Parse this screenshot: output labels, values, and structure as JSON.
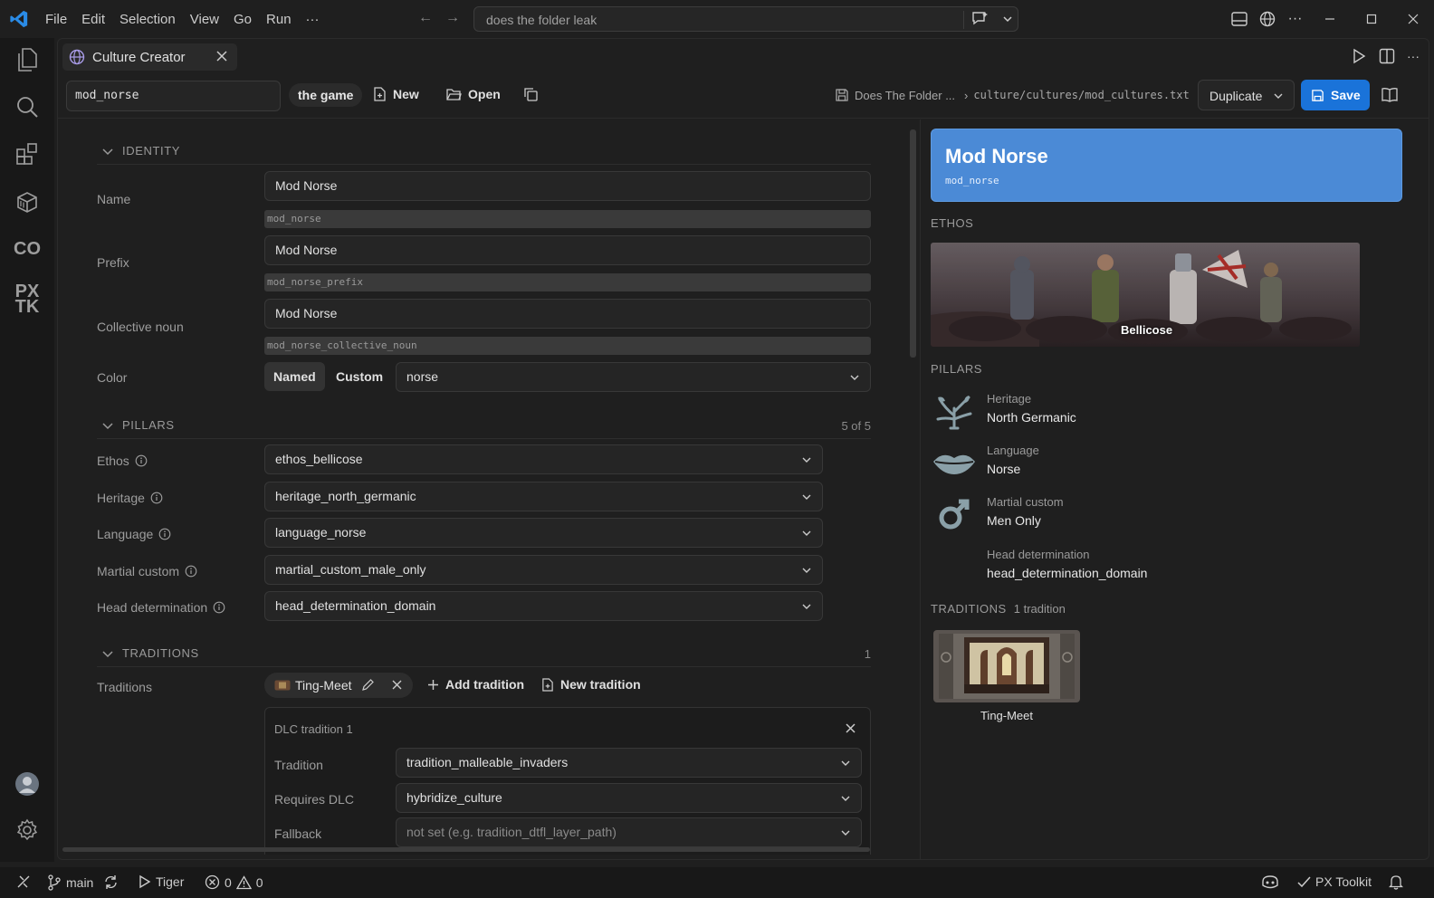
{
  "titlebar": {
    "menu": [
      "File",
      "Edit",
      "Selection",
      "View",
      "Go",
      "Run",
      "···"
    ],
    "command_center": "does the folder leak"
  },
  "editor": {
    "tab_title": "Culture Creator",
    "toolbar": {
      "culture_id": "mod_norse",
      "game_pill": "the game",
      "new_label": "New",
      "open_label": "Open",
      "breadcrumb_project": "Does The Folder ...",
      "breadcrumb_path": "culture/cultures/mod_cultures.txt",
      "duplicate_label": "Duplicate",
      "save_label": "Save"
    },
    "form": {
      "identity": {
        "title": "IDENTITY",
        "name_label": "Name",
        "name_value": "Mod Norse",
        "name_key": "mod_norse",
        "prefix_label": "Prefix",
        "prefix_value": "Mod Norse",
        "prefix_key": "mod_norse_prefix",
        "collective_label": "Collective noun",
        "collective_value": "Mod Norse",
        "collective_key": "mod_norse_collective_noun",
        "color_label": "Color",
        "color_named": "Named",
        "color_custom": "Custom",
        "color_value": "norse"
      },
      "pillars": {
        "title": "PILLARS",
        "count": "5 of 5",
        "rows": [
          {
            "label": "Ethos",
            "value": "ethos_bellicose"
          },
          {
            "label": "Heritage",
            "value": "heritage_north_germanic"
          },
          {
            "label": "Language",
            "value": "language_norse"
          },
          {
            "label": "Martial custom",
            "value": "martial_custom_male_only"
          },
          {
            "label": "Head determination",
            "value": "head_determination_domain"
          }
        ]
      },
      "traditions": {
        "title": "TRADITIONS",
        "count": "1",
        "label": "Traditions",
        "chip": "Ting-Meet",
        "add_label": "Add tradition",
        "new_label": "New tradition",
        "dlc": {
          "title": "DLC tradition 1",
          "tradition_label": "Tradition",
          "tradition_value": "tradition_malleable_invaders",
          "requires_label": "Requires DLC",
          "requires_value": "hybridize_culture",
          "fallback_label": "Fallback",
          "fallback_placeholder": "not set (e.g. tradition_dtfl_layer_path)"
        }
      }
    },
    "preview": {
      "name": "Mod Norse",
      "key": "mod_norse",
      "hero_color": "#4b8ad6",
      "ethos_title": "ETHOS",
      "ethos_caption": "Bellicose",
      "pillars_title": "PILLARS",
      "pillars": [
        {
          "key": "Heritage",
          "value": "North Germanic",
          "icon": "tree-icon"
        },
        {
          "key": "Language",
          "value": "Norse",
          "icon": "lips-icon"
        },
        {
          "key": "Martial custom",
          "value": "Men Only",
          "icon": "male-icon"
        },
        {
          "key": "Head determination",
          "value": "head_determination_domain",
          "icon": ""
        }
      ],
      "traditions_title": "TRADITIONS",
      "traditions_count": "1 tradition",
      "tradition_caption": "Ting-Meet"
    }
  },
  "statusbar": {
    "branch": "main",
    "runner": "Tiger",
    "errors": "0",
    "warnings": "0",
    "toolkit": "PX Toolkit"
  },
  "colors": {
    "accent": "#1a73d9",
    "background": "#1f1f1f"
  }
}
